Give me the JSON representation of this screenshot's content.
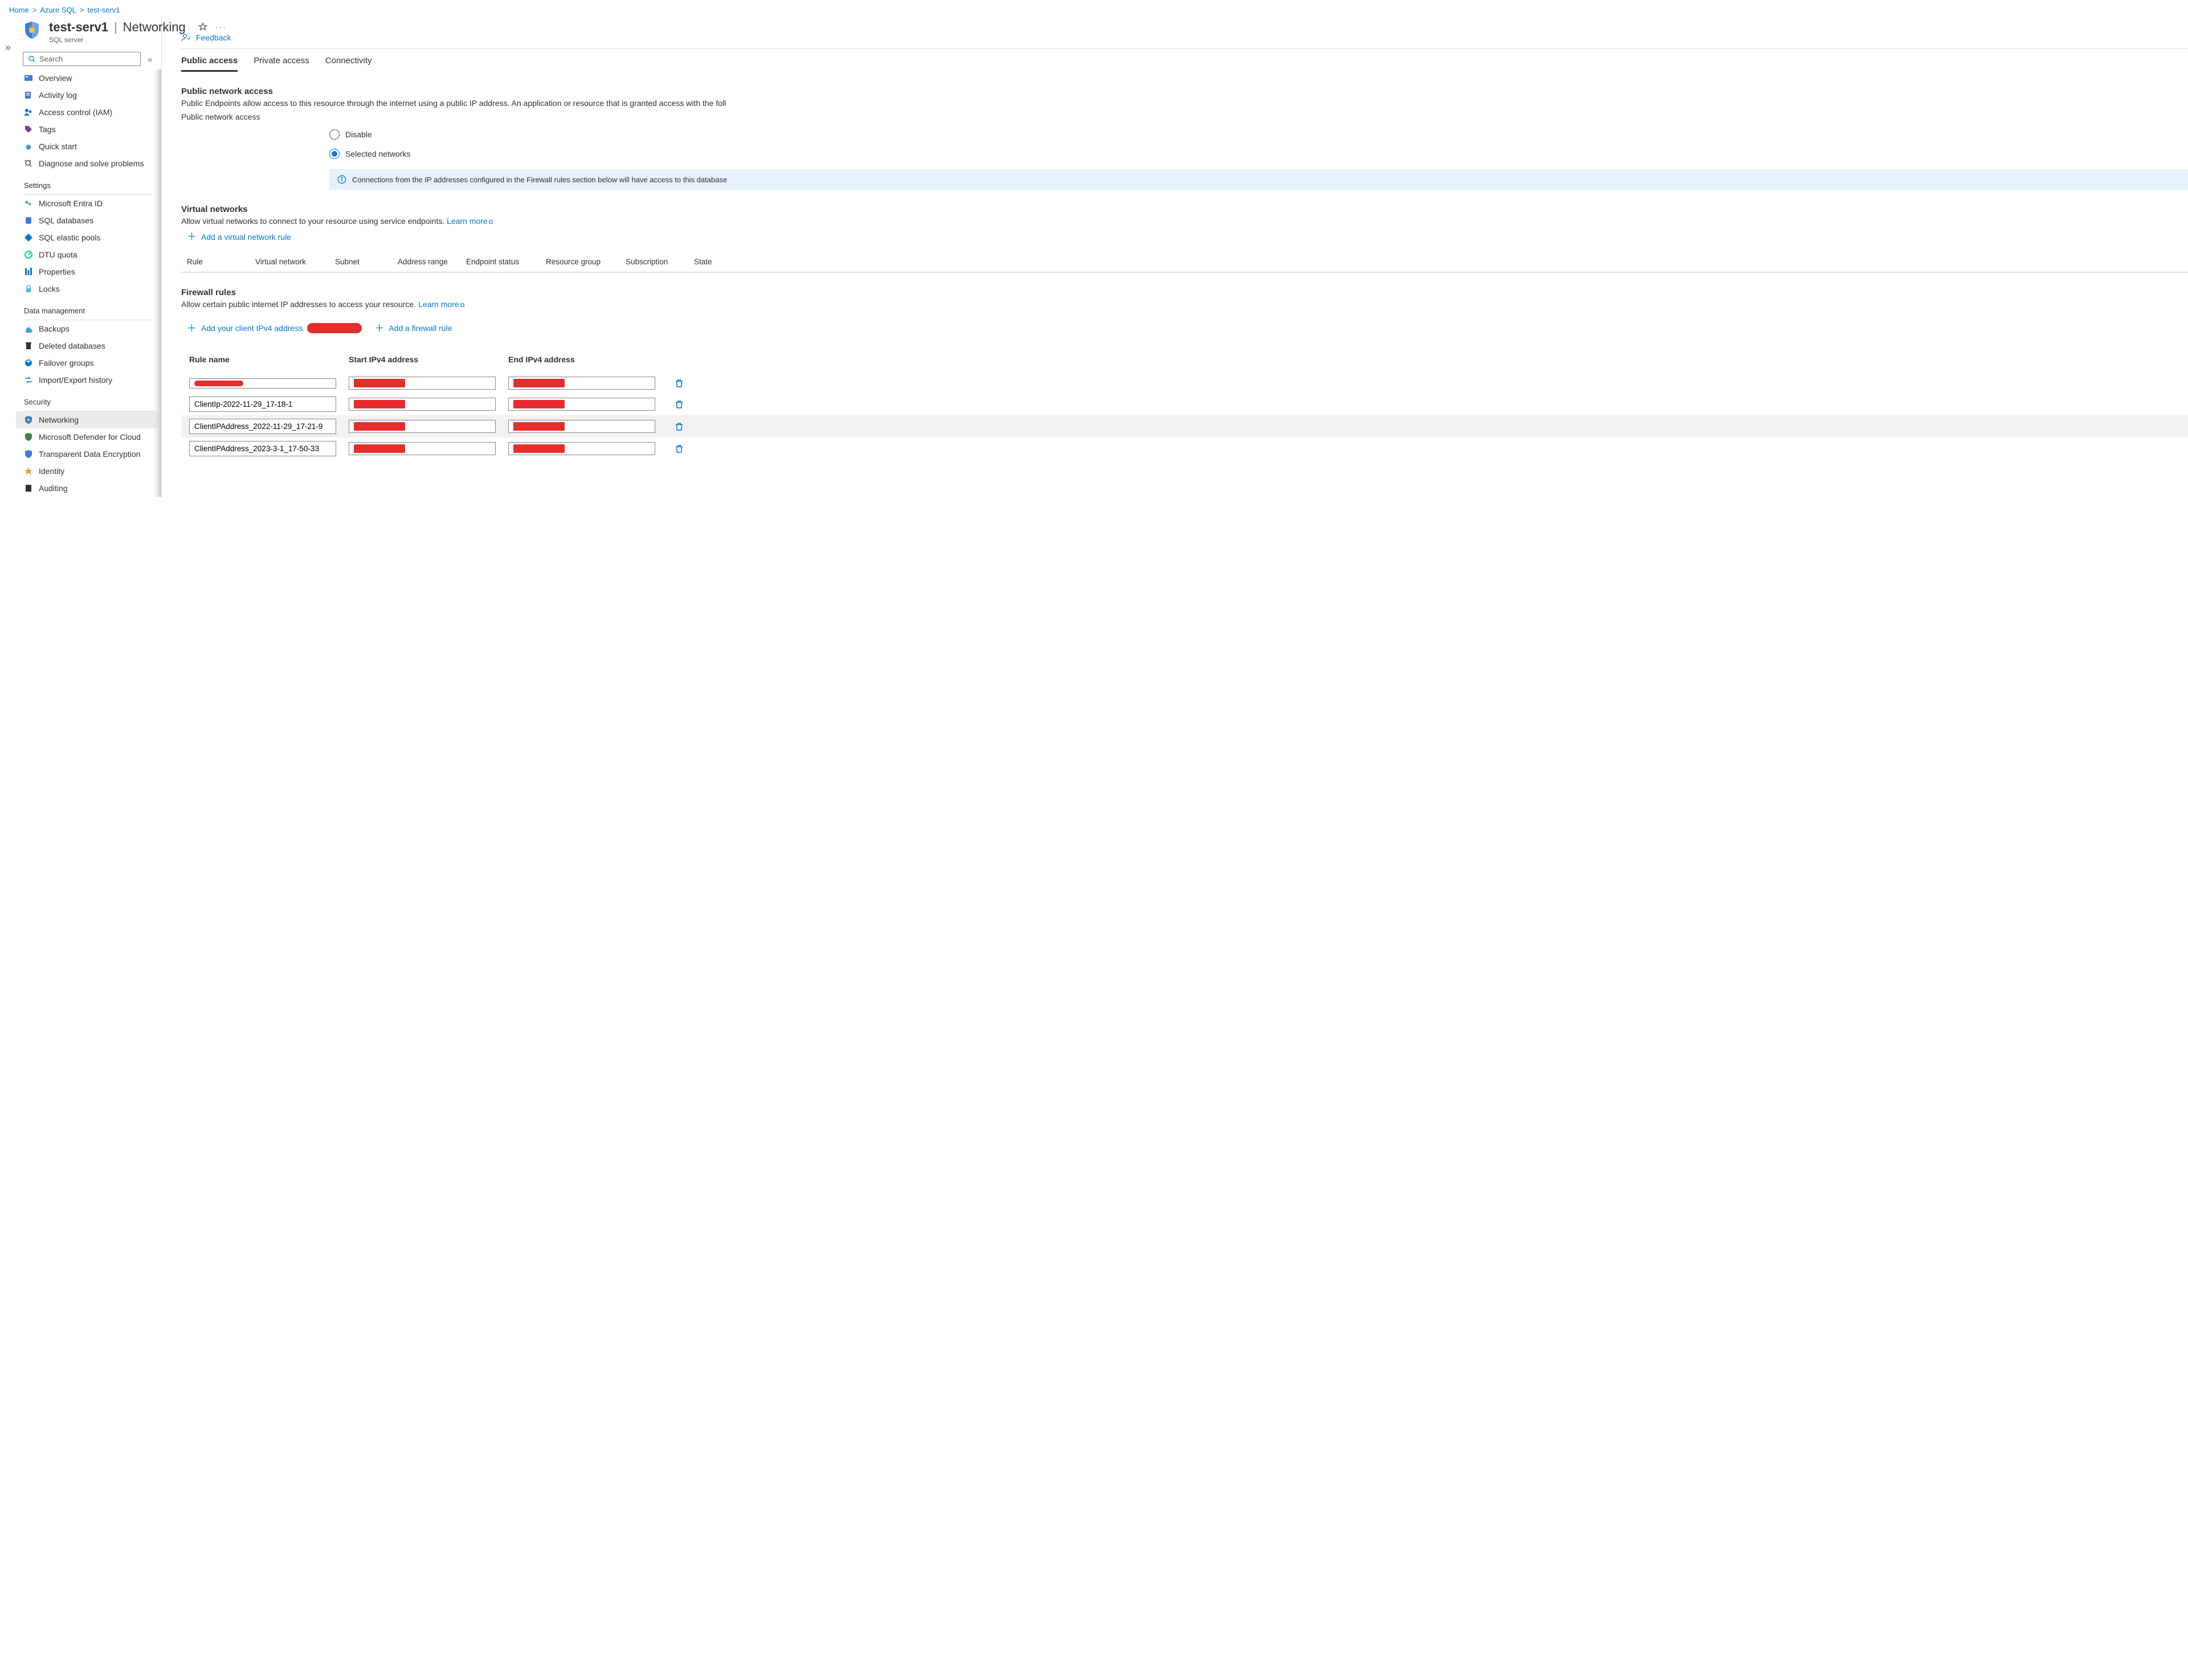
{
  "breadcrumb": [
    {
      "label": "Home"
    },
    {
      "label": "Azure SQL"
    },
    {
      "label": "test-serv1"
    }
  ],
  "header": {
    "resource_name": "test-serv1",
    "blade_name": "Networking",
    "resource_type": "SQL server"
  },
  "search_placeholder": "Search",
  "sidebar": {
    "g0": [
      {
        "key": "overview",
        "label": "Overview"
      },
      {
        "key": "activity-log",
        "label": "Activity log"
      },
      {
        "key": "access-control",
        "label": "Access control (IAM)"
      },
      {
        "key": "tags",
        "label": "Tags"
      },
      {
        "key": "quick-start",
        "label": "Quick start"
      },
      {
        "key": "diagnose",
        "label": "Diagnose and solve problems"
      }
    ],
    "settings_label": "Settings",
    "settings": [
      {
        "key": "entra",
        "label": "Microsoft Entra ID"
      },
      {
        "key": "sqldb",
        "label": "SQL databases"
      },
      {
        "key": "elastic",
        "label": "SQL elastic pools"
      },
      {
        "key": "dtu",
        "label": "DTU quota"
      },
      {
        "key": "properties",
        "label": "Properties"
      },
      {
        "key": "locks",
        "label": "Locks"
      }
    ],
    "datamgmt_label": "Data management",
    "datamgmt": [
      {
        "key": "backups",
        "label": "Backups"
      },
      {
        "key": "deleted",
        "label": "Deleted databases"
      },
      {
        "key": "failover",
        "label": "Failover groups"
      },
      {
        "key": "importexport",
        "label": "Import/Export history"
      }
    ],
    "security_label": "Security",
    "security": [
      {
        "key": "networking",
        "label": "Networking",
        "selected": true
      },
      {
        "key": "defender",
        "label": "Microsoft Defender for Cloud"
      },
      {
        "key": "tde",
        "label": "Transparent Data Encryption"
      },
      {
        "key": "identity",
        "label": "Identity"
      },
      {
        "key": "auditing",
        "label": "Auditing"
      }
    ]
  },
  "main": {
    "feedback": "Feedback",
    "tabs": {
      "public": "Public access",
      "private": "Private access",
      "connectivity": "Connectivity"
    },
    "public": {
      "heading": "Public network access",
      "desc": "Public Endpoints allow access to this resource through the internet using a public IP address. An application or resource that is granted access with the foll",
      "sub": "Public network access",
      "opt_disable": "Disable",
      "opt_selected": "Selected networks",
      "info": "Connections from the IP addresses configured in the Firewall rules section below will have access to this database"
    },
    "vnet": {
      "heading": "Virtual networks",
      "desc": "Allow virtual networks to connect to your resource using service endpoints. ",
      "learn": "Learn more",
      "add": "Add a virtual network rule",
      "cols": {
        "rule": "Rule",
        "vn": "Virtual network",
        "subnet": "Subnet",
        "addr": "Address range",
        "endpoint": "Endpoint status",
        "rg": "Resource group",
        "sub": "Subscription",
        "state": "State"
      }
    },
    "fw": {
      "heading": "Firewall rules",
      "desc": "Allow certain public internet IP addresses to access your resource. ",
      "learn": "Learn more",
      "add_client": "Add your client IPv4 address ",
      "add_rule": "Add a firewall rule",
      "cols": {
        "name": "Rule name",
        "start": "Start IPv4 address",
        "end": "End IPv4 address"
      },
      "rows": [
        {
          "name_redacted": true
        },
        {
          "name": "ClientIp-2022-11-29_17-18-1"
        },
        {
          "name": "ClientIPAddress_2022-11-29_17-21-9",
          "hover": true
        },
        {
          "name": "ClientIPAddress_2023-3-1_17-50-33"
        }
      ]
    }
  }
}
